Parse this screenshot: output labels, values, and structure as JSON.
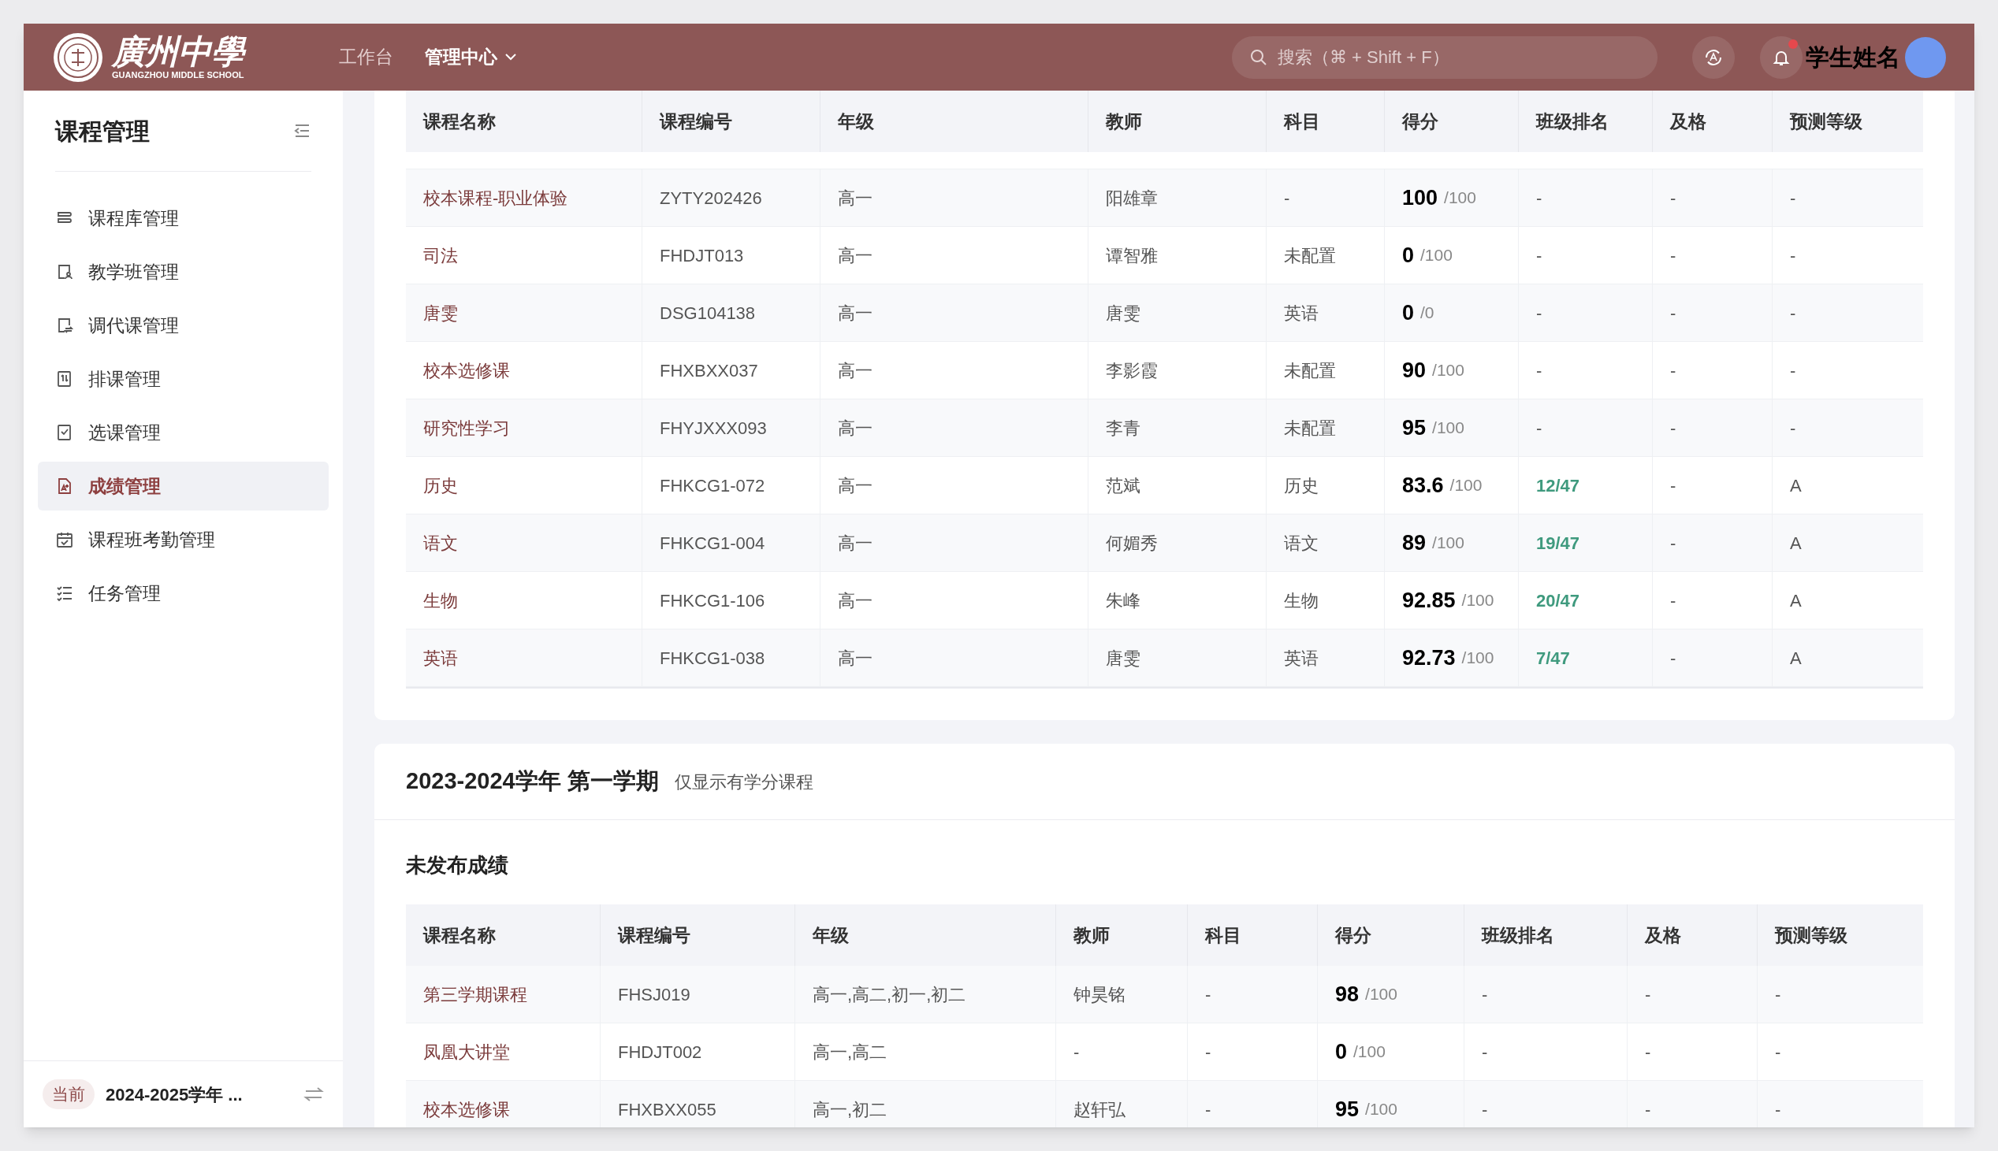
{
  "header": {
    "logo": {
      "name": "廣州中學",
      "subtitle": "GUANGZHOU MIDDLE SCHOOL"
    },
    "nav": [
      {
        "label": "工作台",
        "selected": false,
        "dropdown": false
      },
      {
        "label": "管理中心",
        "selected": true,
        "dropdown": true
      }
    ],
    "search": {
      "placeholder": "搜索（⌘ + Shift + F）"
    },
    "notifications": {
      "unread": true
    },
    "user": {
      "name": "学生姓名"
    }
  },
  "sidebar": {
    "title": "课程管理",
    "items": [
      {
        "label": "课程库管理",
        "selected": false
      },
      {
        "label": "教学班管理",
        "selected": false
      },
      {
        "label": "调代课管理",
        "selected": false
      },
      {
        "label": "排课管理",
        "selected": false
      },
      {
        "label": "选课管理",
        "selected": false
      },
      {
        "label": "成绩管理",
        "selected": true
      },
      {
        "label": "课程班考勤管理",
        "selected": false
      },
      {
        "label": "任务管理",
        "selected": false
      }
    ],
    "footer": {
      "badge": "当前",
      "term": "2024-2025学年 ..."
    }
  },
  "top_table": {
    "columns": [
      "课程名称",
      "课程编号",
      "年级",
      "教师",
      "科目",
      "得分",
      "班级排名",
      "及格",
      "预测等级"
    ],
    "rows": [
      {
        "name": "校本课程-职业体验",
        "code": "ZYTY202426",
        "grade": "高一",
        "teacher": "阳雄章",
        "subject": "-",
        "score": "100",
        "total": "/100",
        "rank": "-",
        "ranked": false,
        "pass": "-",
        "level": "-"
      },
      {
        "name": "司法",
        "code": "FHDJT013",
        "grade": "高一",
        "teacher": "谭智雅",
        "subject": "未配置",
        "score": "0",
        "total": "/100",
        "rank": "-",
        "ranked": false,
        "pass": "-",
        "level": "-"
      },
      {
        "name": "唐雯",
        "code": "DSG104138",
        "grade": "高一",
        "teacher": "唐雯",
        "subject": "英语",
        "score": "0",
        "total": "/0",
        "rank": "-",
        "ranked": false,
        "pass": "-",
        "level": "-"
      },
      {
        "name": "校本选修课",
        "code": "FHXBXX037",
        "grade": "高一",
        "teacher": "李影霞",
        "subject": "未配置",
        "score": "90",
        "total": "/100",
        "rank": "-",
        "ranked": false,
        "pass": "-",
        "level": "-"
      },
      {
        "name": "研究性学习",
        "code": "FHYJXXX093",
        "grade": "高一",
        "teacher": "李青",
        "subject": "未配置",
        "score": "95",
        "total": "/100",
        "rank": "-",
        "ranked": false,
        "pass": "-",
        "level": "-"
      },
      {
        "name": "历史",
        "code": "FHKCG1-072",
        "grade": "高一",
        "teacher": "范斌",
        "subject": "历史",
        "score": "83.6",
        "total": "/100",
        "rank": "12/47",
        "ranked": true,
        "pass": "-",
        "level": "A"
      },
      {
        "name": "语文",
        "code": "FHKCG1-004",
        "grade": "高一",
        "teacher": "何媚秀",
        "subject": "语文",
        "score": "89",
        "total": "/100",
        "rank": "19/47",
        "ranked": true,
        "pass": "-",
        "level": "A"
      },
      {
        "name": "生物",
        "code": "FHKCG1-106",
        "grade": "高一",
        "teacher": "朱峰",
        "subject": "生物",
        "score": "92.85",
        "total": "/100",
        "rank": "20/47",
        "ranked": true,
        "pass": "-",
        "level": "A"
      },
      {
        "name": "英语",
        "code": "FHKCG1-038",
        "grade": "高一",
        "teacher": "唐雯",
        "subject": "英语",
        "score": "92.73",
        "total": "/100",
        "rank": "7/47",
        "ranked": true,
        "pass": "-",
        "level": "A"
      }
    ]
  },
  "term_card": {
    "title": "2023-2024学年 第一学期",
    "note": "仅显示有学分课程",
    "section": "未发布成绩",
    "table": {
      "columns": [
        "课程名称",
        "课程编号",
        "年级",
        "教师",
        "科目",
        "得分",
        "班级排名",
        "及格",
        "预测等级"
      ],
      "rows": [
        {
          "name": "第三学期课程",
          "code": "FHSJ019",
          "grade": "高一,高二,初一,初二",
          "teacher": "钟昊铭",
          "subject": "-",
          "score": "98",
          "total": "/100",
          "rank": "-",
          "ranked": false,
          "pass": "-",
          "level": "-"
        },
        {
          "name": "凤凰大讲堂",
          "code": "FHDJT002",
          "grade": "高一,高二",
          "teacher": "-",
          "subject": "-",
          "score": "0",
          "total": "/100",
          "rank": "-",
          "ranked": false,
          "pass": "-",
          "level": "-"
        },
        {
          "name": "校本选修课",
          "code": "FHXBXX055",
          "grade": "高一,初二",
          "teacher": "赵轩弘",
          "subject": "-",
          "score": "95",
          "total": "/100",
          "rank": "-",
          "ranked": false,
          "pass": "-",
          "level": "-"
        }
      ]
    }
  }
}
